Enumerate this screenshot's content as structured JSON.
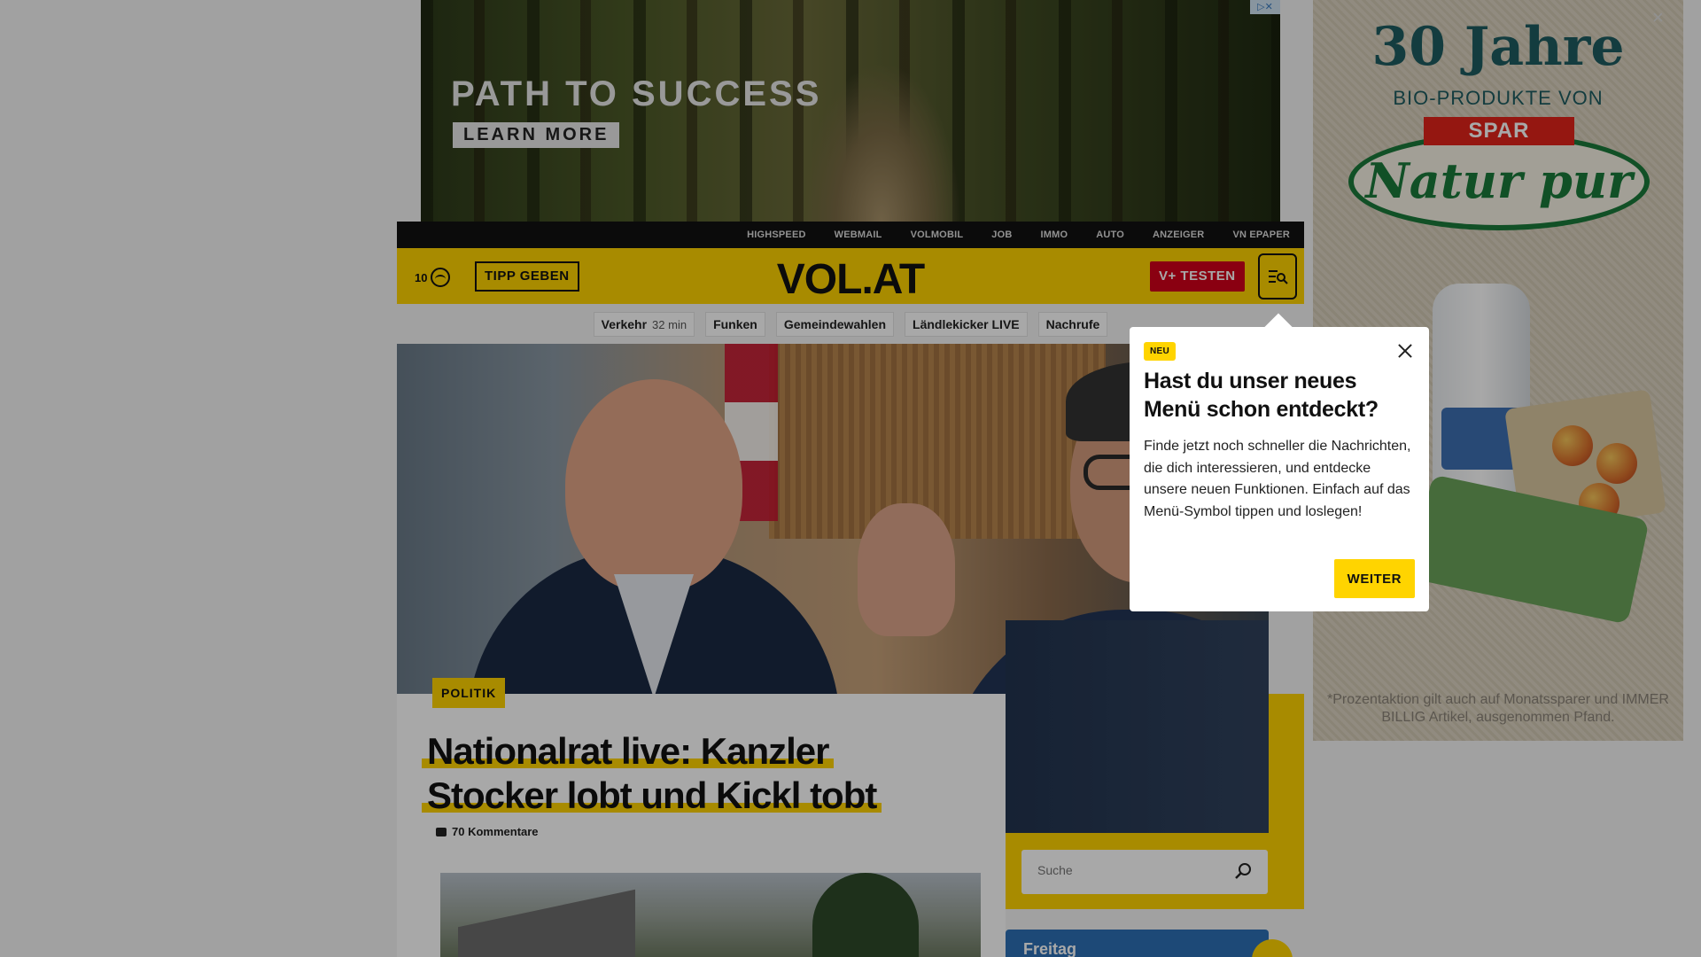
{
  "ad_top": {
    "headline": "PATH TO SUCCESS",
    "cta": "LEARN MORE"
  },
  "ad_right": {
    "line1": "30 Jahre",
    "line2": "BIO-PRODUKTE VON",
    "brand": "SPAR",
    "brand2": "Natur pur",
    "footnote": "*Prozentaktion gilt auch auf Monatssparer und IMMER BILLIG Artikel, ausgenommen Pfand."
  },
  "topbar": {
    "items": [
      "HIGHSPEED",
      "WEBMAIL",
      "VOLMOBIL",
      "JOB",
      "IMMO",
      "AUTO",
      "ANZEIGER",
      "VN EPAPER"
    ]
  },
  "header": {
    "weather_value": "10",
    "tipp_label": "TIPP GEBEN",
    "logo": "VOL.AT",
    "vplus_label": "V+ TESTEN"
  },
  "tags": [
    {
      "label": "Verkehr",
      "meta": "32 min"
    },
    {
      "label": "Funken",
      "meta": ""
    },
    {
      "label": "Gemeindewahlen",
      "meta": ""
    },
    {
      "label": "Ländlekicker LIVE",
      "meta": ""
    },
    {
      "label": "Nachrufe",
      "meta": ""
    }
  ],
  "article": {
    "category": "POLITIK",
    "title_line1": "Nationalrat live: Kanzler",
    "title_line2": "Stocker lobt und Kickl tobt",
    "comments": "70 Kommentare"
  },
  "search": {
    "placeholder": "Suche"
  },
  "day_card": {
    "label": "Freitag"
  },
  "popup": {
    "badge": "NEU",
    "title": "Hast du unser neues Menü schon entdeckt?",
    "body": "Finde jetzt noch schneller die Nachrichten, die dich interessieren, und entdecke unsere neuen Funktionen. Einfach auf das Menü-Symbol tippen und loslegen!",
    "button": "WEITER"
  },
  "colors": {
    "brand_yellow": "#ffd400",
    "vplus_red": "#d2001a",
    "topbar_black": "#111111"
  }
}
